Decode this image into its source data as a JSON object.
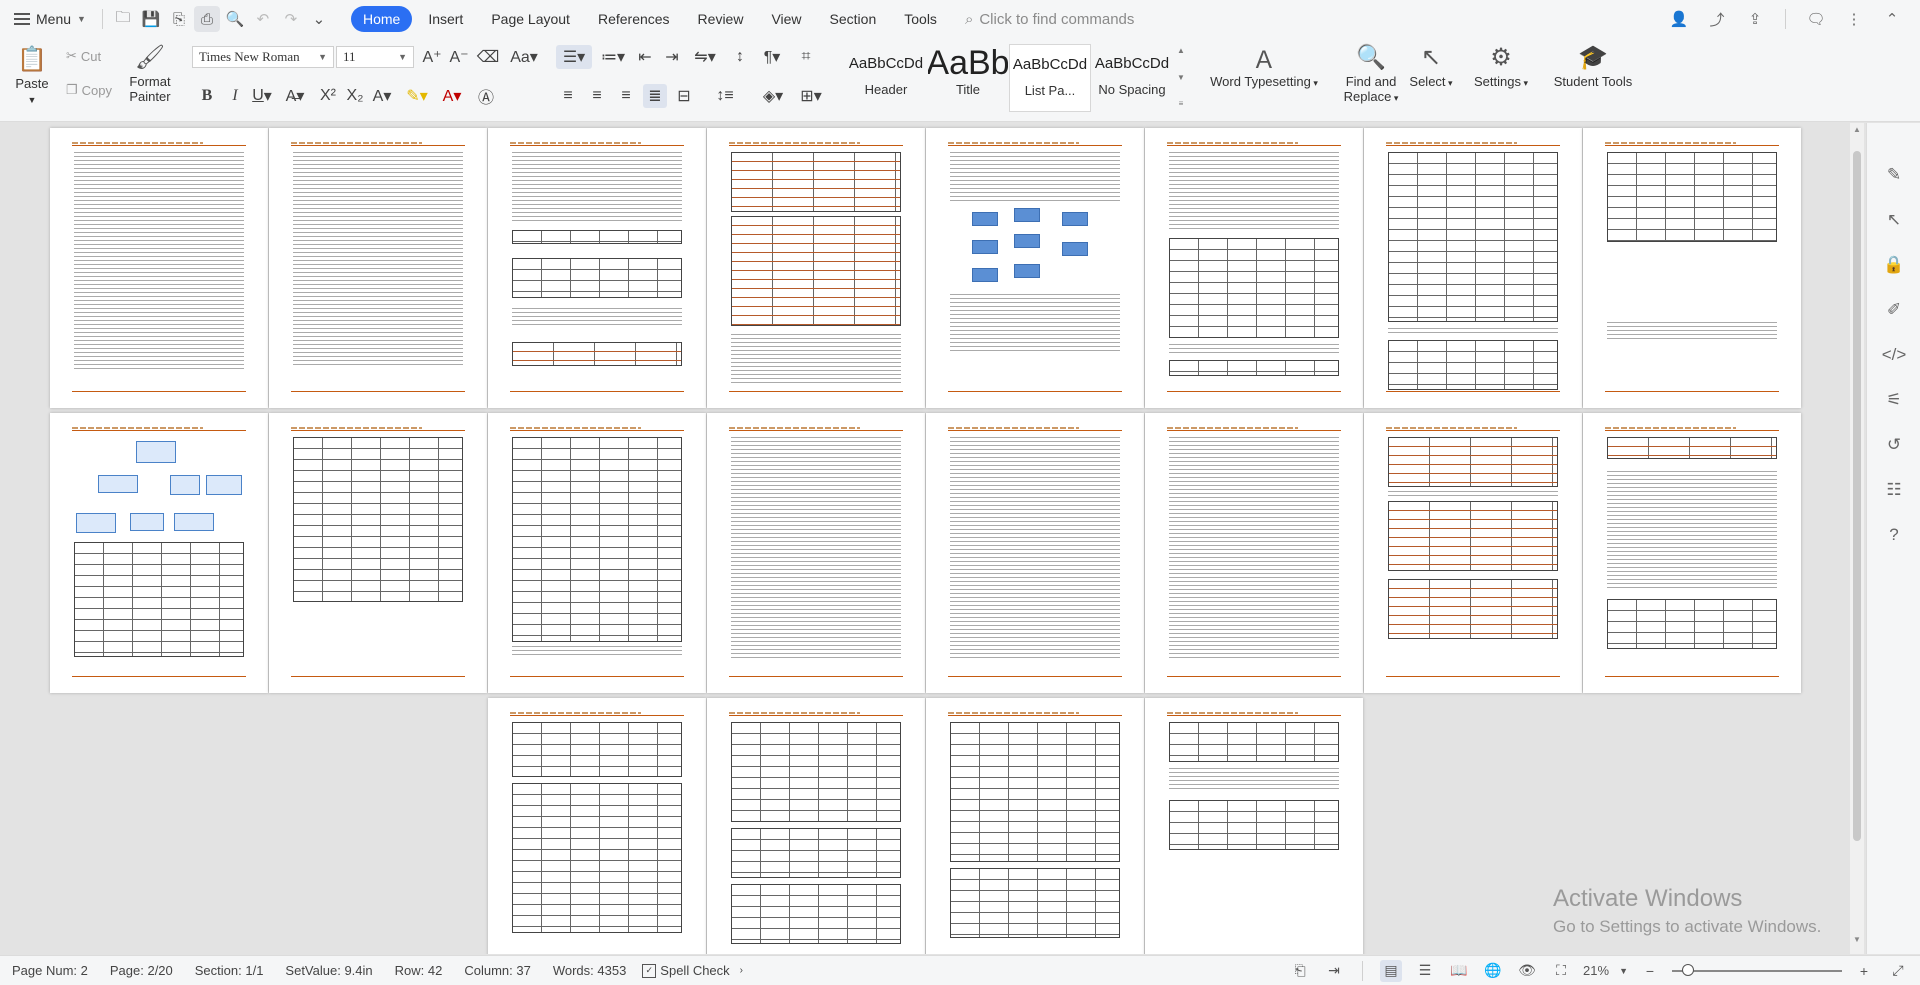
{
  "topbar": {
    "menu_label": "Menu",
    "tabs": [
      "Home",
      "Insert",
      "Page Layout",
      "References",
      "Review",
      "View",
      "Section",
      "Tools"
    ],
    "active_tab": "Home",
    "command_search_placeholder": "Click to find commands"
  },
  "ribbon": {
    "paste": "Paste",
    "cut": "Cut",
    "copy": "Copy",
    "format_painter": "Format Painter",
    "font_name": "Times New Roman",
    "font_size": "11",
    "styles": [
      {
        "sample": "AaBbCcDd",
        "name": "Header"
      },
      {
        "sample": "AaBb",
        "name": "Title"
      },
      {
        "sample": "AaBbCcDd",
        "name": "List Pa..."
      },
      {
        "sample": "AaBbCcDd",
        "name": "No Spacing"
      }
    ],
    "word_typesetting": "Word Typesetting",
    "find_replace": "Find and Replace",
    "select": "Select",
    "settings": "Settings",
    "student_tools": "Student Tools"
  },
  "watermark": {
    "title": "Activate Windows",
    "subtitle": "Go to Settings to activate Windows."
  },
  "statusbar": {
    "page_num": "Page Num: 2",
    "page": "Page: 2/20",
    "section": "Section: 1/1",
    "setvalue": "SetValue: 9.4in",
    "row": "Row: 42",
    "column": "Column: 37",
    "words": "Words: 4353",
    "spell_check": "Spell Check",
    "zoom": "21%"
  },
  "colors": {
    "accent": "#2b6ff3",
    "header_line": "#c55a11",
    "diagram_blue": "#5b8fd4"
  }
}
